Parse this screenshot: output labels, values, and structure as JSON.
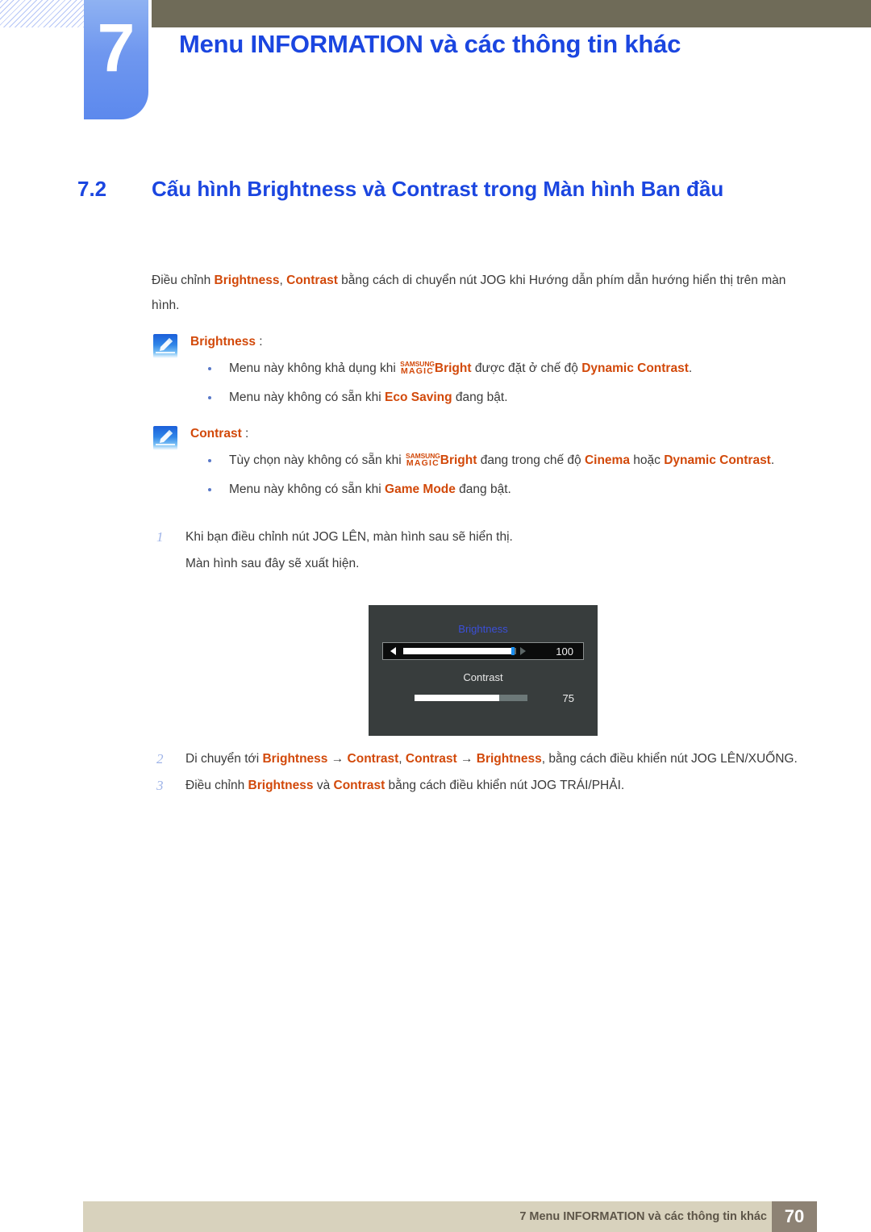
{
  "header": {
    "chapter_number": "7",
    "chapter_title": "Menu INFORMATION và các thông tin khác",
    "accent_blue": "#1b46e0",
    "bar_color": "#6f6b58"
  },
  "section": {
    "number": "7.2",
    "title": "Cấu hình Brightness và Contrast trong Màn hình Ban đầu"
  },
  "intro": {
    "p1_a": "Điều chỉnh ",
    "p1_b1": "Brightness",
    "p1_c": ", ",
    "p1_b2": "Contrast",
    "p1_d": " bằng cách di chuyển nút JOG khi Hướng dẫn phím dẫn hướng hiển thị trên màn hình."
  },
  "notes": [
    {
      "icon": "note-pen-icon",
      "title": "Brightness",
      "colon": " :",
      "bullets": [
        {
          "a": "Menu này không khả dụng khi ",
          "magic_top": "SAMSUNG",
          "magic_bottom": "MAGIC",
          "magic_word": "Bright",
          "b": " được đặt ở chế độ ",
          "hl": "Dynamic Contrast",
          "c": "."
        },
        {
          "a": "Menu này không có sẵn khi ",
          "hl": "Eco Saving",
          "b": " đang bật."
        }
      ]
    },
    {
      "icon": "note-pen-icon",
      "title": "Contrast",
      "colon": " :",
      "bullets": [
        {
          "a": "Tùy chọn này không có sẵn khi ",
          "magic_top": "SAMSUNG",
          "magic_bottom": "MAGIC",
          "magic_word": "Bright",
          "b": " đang trong chế độ ",
          "hl": "Cinema",
          "c": " hoặc ",
          "hl2": "Dynamic Contrast",
          "d": "."
        },
        {
          "a": "Menu này không có sẵn khi ",
          "hl": "Game Mode",
          "b": " đang bật."
        }
      ]
    }
  ],
  "steps": {
    "step1_num": "1",
    "step1_text": "Khi bạn điều chỉnh nút JOG LÊN, màn hình sau sẽ hiển thị.",
    "step1_sub": "Màn hình sau đây sẽ xuất hiện.",
    "step2_num": "2",
    "step2_a": "Di chuyển tới ",
    "step2_b1": "Brightness",
    "step2_arrow1": " → ",
    "step2_b2": "Contrast",
    "step2_c": ", ",
    "step2_b3": "Contrast",
    "step2_arrow2": " → ",
    "step2_b4": "Brightness",
    "step2_d": ", bằng cách điều khiển nút JOG LÊN/XUỐNG.",
    "step3_num": "3",
    "step3_a": "Điều chỉnh ",
    "step3_b1": "Brightness",
    "step3_mid": " và ",
    "step3_b2": "Contrast",
    "step3_d": " bằng cách điều khiển nút JOG TRÁI/PHẢI."
  },
  "osd": {
    "brightness_label": "Brightness",
    "brightness_value": "100",
    "brightness_fill_percent": 97,
    "contrast_label": "Contrast",
    "contrast_value": "75",
    "contrast_fill_percent": 75,
    "panel_color": "#383d3d",
    "label_blue": "#3b4fd8",
    "knob_blue": "#1a8ef0"
  },
  "footer": {
    "text": "7 Menu INFORMATION và các thông tin khác",
    "page": "70",
    "bar_color": "#d8d2bd",
    "page_color": "#8d8274"
  }
}
